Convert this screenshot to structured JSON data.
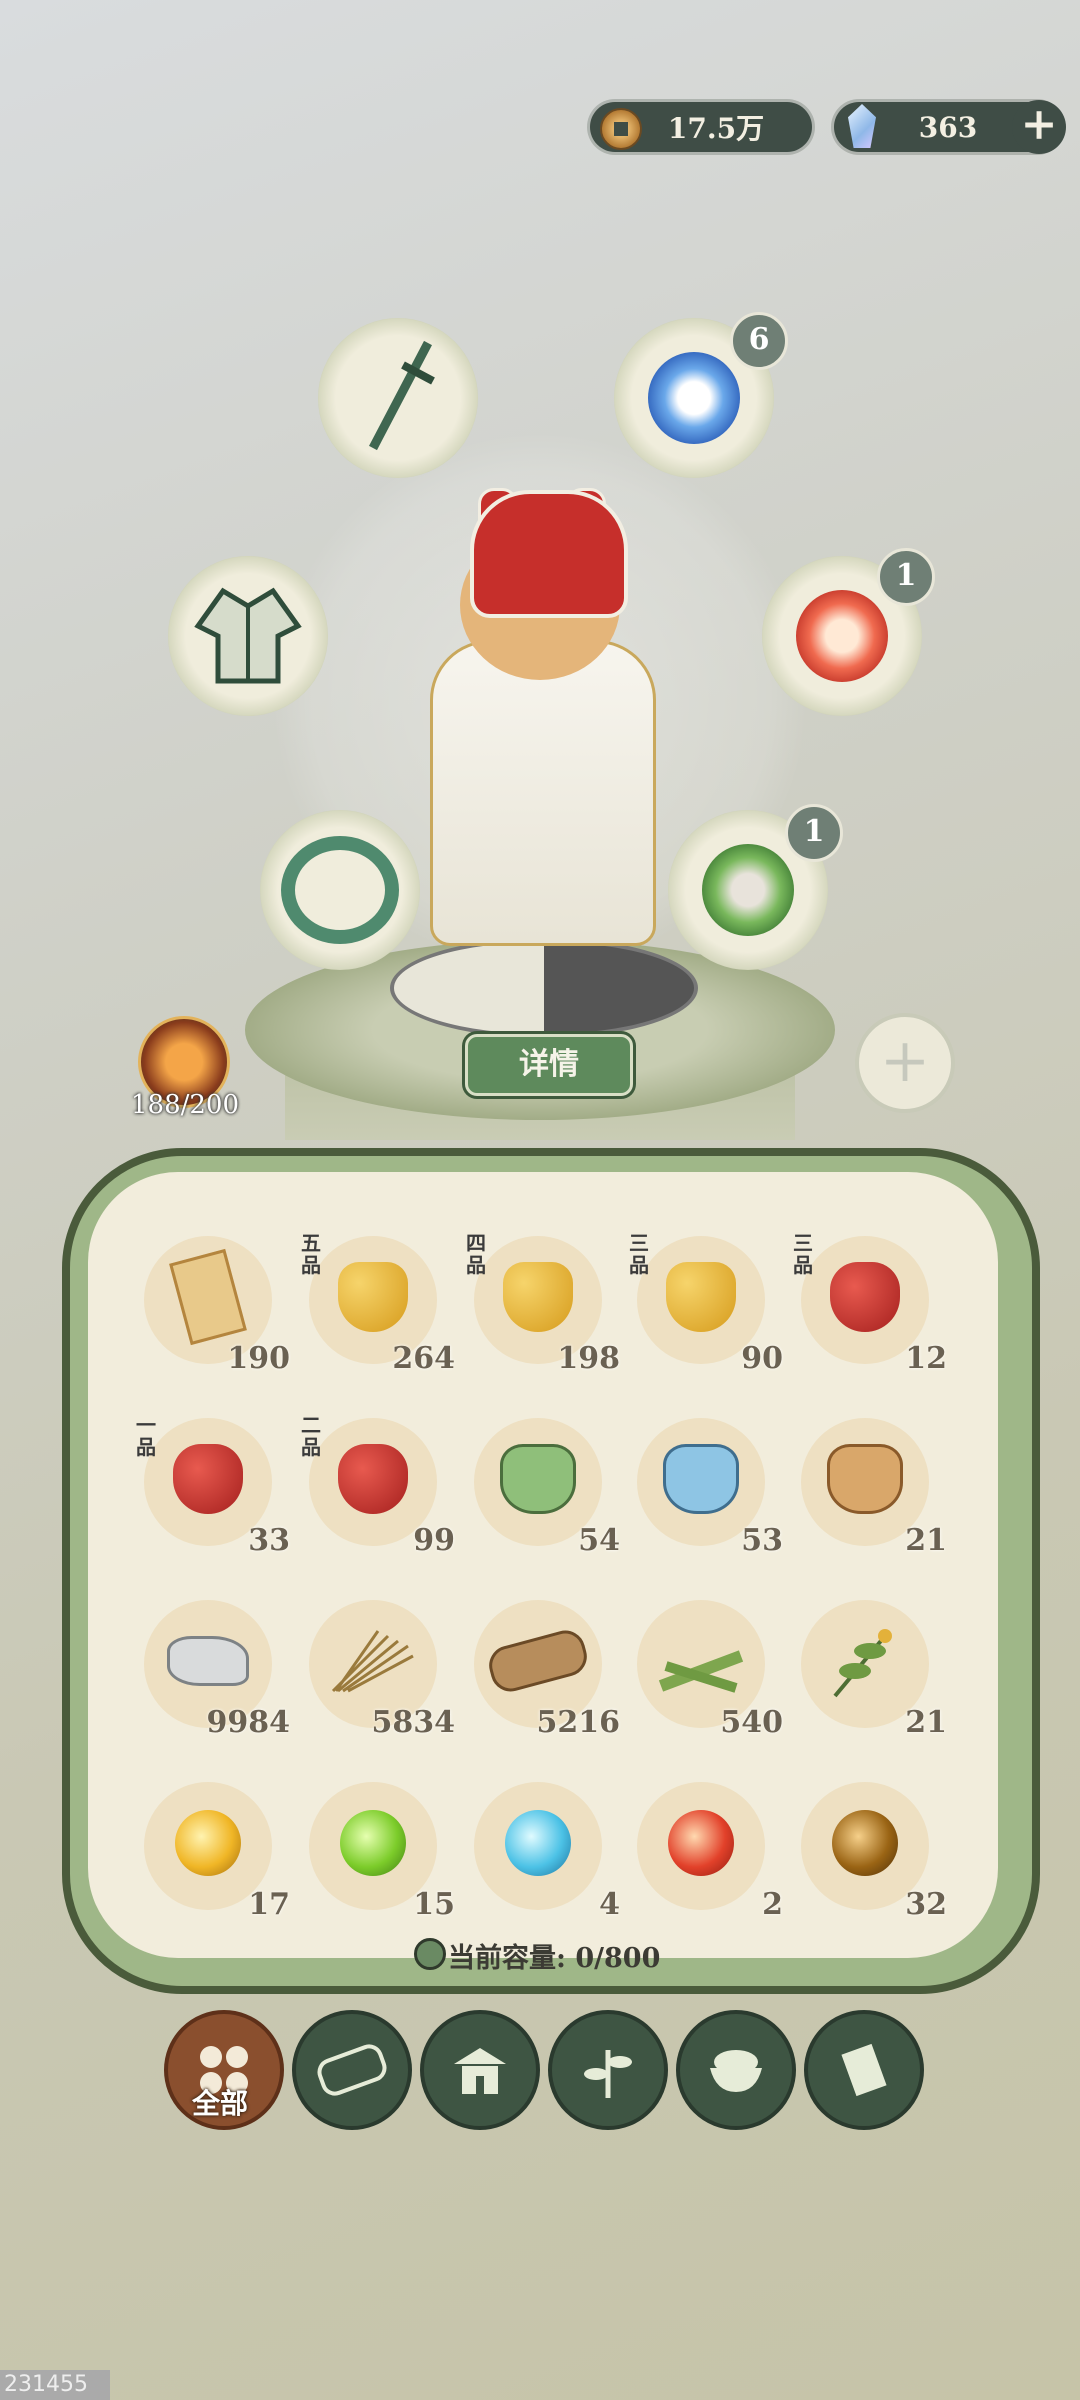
{
  "currency": {
    "coins": "17.5万",
    "gems": "363",
    "coin_icon": "coin-icon",
    "gem_icon": "gem-icon",
    "add_label": "+"
  },
  "equipment": {
    "weapon_icon": "sword-icon",
    "armor_icon": "robe-icon",
    "accessory_icon": "jade-bracelet-icon",
    "spirits": [
      {
        "icon": "blue-spirit-icon",
        "count": "6"
      },
      {
        "icon": "red-spirit-icon",
        "count": "1"
      },
      {
        "icon": "green-spirit-icon",
        "count": "1"
      }
    ]
  },
  "character": {
    "details_label": "详情",
    "add_slot_label": "+",
    "level": "188/200"
  },
  "inventory": {
    "items": [
      {
        "icon": "scroll-icon",
        "grade": "",
        "count": "190"
      },
      {
        "icon": "golden-grape-icon",
        "grade": "五品",
        "count": "264"
      },
      {
        "icon": "golden-grape-icon",
        "grade": "四品",
        "count": "198"
      },
      {
        "icon": "golden-grape-icon",
        "grade": "三品",
        "count": "90"
      },
      {
        "icon": "red-berry-icon",
        "grade": "三品",
        "count": "12"
      },
      {
        "icon": "red-berry-icon",
        "grade": "一品",
        "count": "33"
      },
      {
        "icon": "red-berry-icon",
        "grade": "二品",
        "count": "99"
      },
      {
        "icon": "green-bag-icon",
        "grade": "",
        "count": "54"
      },
      {
        "icon": "blue-bag-icon",
        "grade": "",
        "count": "53"
      },
      {
        "icon": "brown-bag-icon",
        "grade": "",
        "count": "21"
      },
      {
        "icon": "stone-icon",
        "grade": "",
        "count": "9984"
      },
      {
        "icon": "straw-icon",
        "grade": "",
        "count": "5834"
      },
      {
        "icon": "log-icon",
        "grade": "",
        "count": "5216"
      },
      {
        "icon": "bamboo-icon",
        "grade": "",
        "count": "540"
      },
      {
        "icon": "herb-icon",
        "grade": "",
        "count": "21"
      },
      {
        "icon": "gold-orb-icon",
        "grade": "",
        "count": "17"
      },
      {
        "icon": "green-orb-icon",
        "grade": "",
        "count": "15"
      },
      {
        "icon": "blue-orb-icon",
        "grade": "",
        "count": "4"
      },
      {
        "icon": "red-orb-icon",
        "grade": "",
        "count": "2"
      },
      {
        "icon": "amber-orb-icon",
        "grade": "",
        "count": "32"
      }
    ],
    "capacity_label": "当前容量: 0/800"
  },
  "tabs": [
    {
      "icon": "all-icon",
      "label": "全部"
    },
    {
      "icon": "log-tab-icon"
    },
    {
      "icon": "building-icon"
    },
    {
      "icon": "herb-tab-icon"
    },
    {
      "icon": "food-bowl-icon"
    },
    {
      "icon": "scroll-tab-icon"
    }
  ],
  "watermark": "231455"
}
